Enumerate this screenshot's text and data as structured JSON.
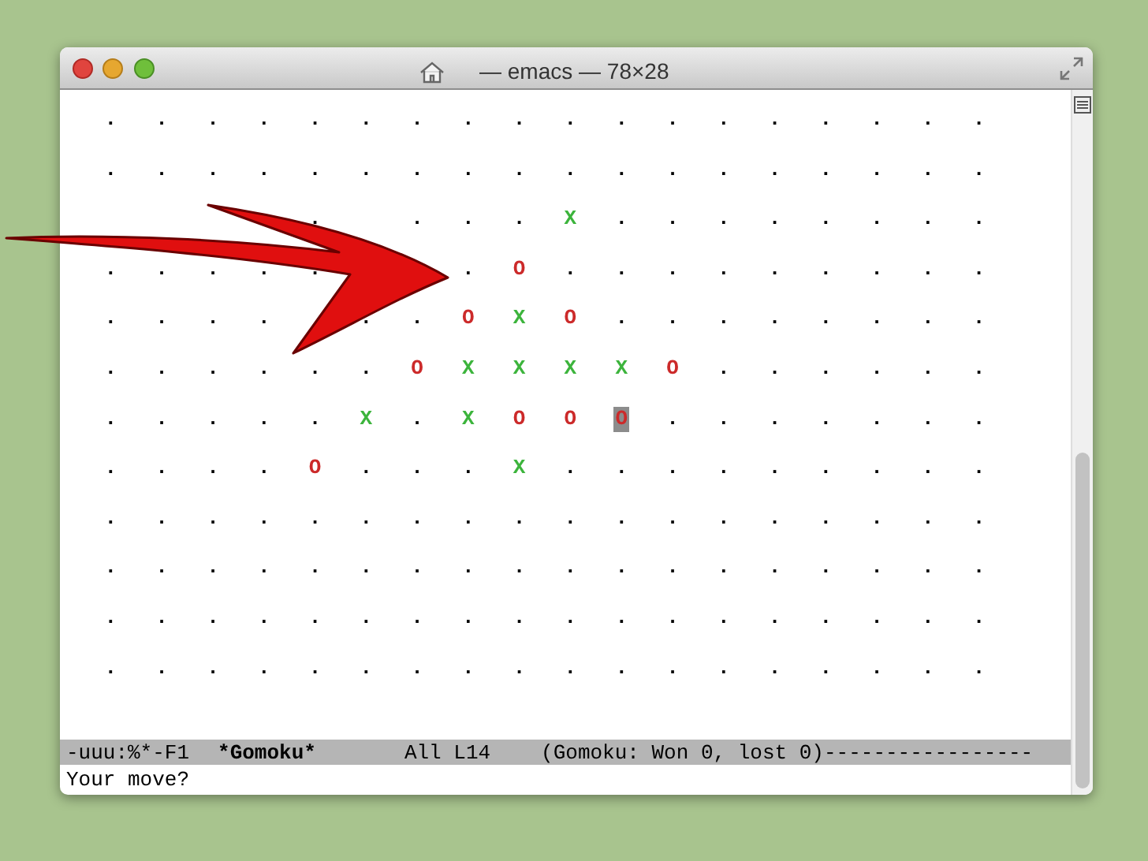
{
  "window": {
    "title": "— emacs — 78×28"
  },
  "board": {
    "rows": [
      [
        ".",
        ".",
        ".",
        ".",
        ".",
        ".",
        ".",
        ".",
        ".",
        ".",
        ".",
        ".",
        ".",
        ".",
        ".",
        ".",
        ".",
        "."
      ],
      [
        ".",
        ".",
        ".",
        ".",
        ".",
        ".",
        ".",
        ".",
        ".",
        ".",
        ".",
        ".",
        ".",
        ".",
        ".",
        ".",
        ".",
        "."
      ],
      [
        null,
        null,
        null,
        null,
        ".",
        null,
        ".",
        ".",
        ".",
        "X",
        ".",
        ".",
        ".",
        ".",
        ".",
        ".",
        ".",
        "."
      ],
      [
        ".",
        ".",
        ".",
        ".",
        ".",
        null,
        null,
        ".",
        "O",
        ".",
        ".",
        ".",
        ".",
        ".",
        ".",
        ".",
        ".",
        "."
      ],
      [
        ".",
        ".",
        ".",
        ".",
        null,
        ".",
        ".",
        "O",
        "X",
        "O",
        ".",
        ".",
        ".",
        ".",
        ".",
        ".",
        ".",
        "."
      ],
      [
        ".",
        ".",
        ".",
        ".",
        ".",
        ".",
        "O",
        "X",
        "X",
        "X",
        "X",
        "O",
        ".",
        ".",
        ".",
        ".",
        ".",
        "."
      ],
      [
        ".",
        ".",
        ".",
        ".",
        ".",
        "X",
        ".",
        "X",
        "O",
        "O",
        {
          "mark": "O",
          "cursor": true
        },
        ".",
        ".",
        ".",
        ".",
        ".",
        ".",
        "."
      ],
      [
        ".",
        ".",
        ".",
        ".",
        "O",
        ".",
        ".",
        ".",
        "X",
        ".",
        ".",
        ".",
        ".",
        ".",
        ".",
        ".",
        ".",
        "."
      ],
      [
        ".",
        ".",
        ".",
        ".",
        ".",
        ".",
        ".",
        ".",
        ".",
        ".",
        ".",
        ".",
        ".",
        ".",
        ".",
        ".",
        ".",
        "."
      ],
      [
        ".",
        ".",
        ".",
        ".",
        ".",
        ".",
        ".",
        ".",
        ".",
        ".",
        ".",
        ".",
        ".",
        ".",
        ".",
        ".",
        ".",
        "."
      ],
      [
        ".",
        ".",
        ".",
        ".",
        ".",
        ".",
        ".",
        ".",
        ".",
        ".",
        ".",
        ".",
        ".",
        ".",
        ".",
        ".",
        ".",
        "."
      ],
      [
        ".",
        ".",
        ".",
        ".",
        ".",
        ".",
        ".",
        ".",
        ".",
        ".",
        ".",
        ".",
        ".",
        ".",
        ".",
        ".",
        ".",
        "."
      ]
    ]
  },
  "mode_line": {
    "status": "-uuu:%*-F1",
    "buffer": "*Gomoku*",
    "position": "All L14",
    "mode": "(Gomoku: Won 0, lost 0)",
    "fill": "-----------------"
  },
  "minibuffer": "Your move?"
}
